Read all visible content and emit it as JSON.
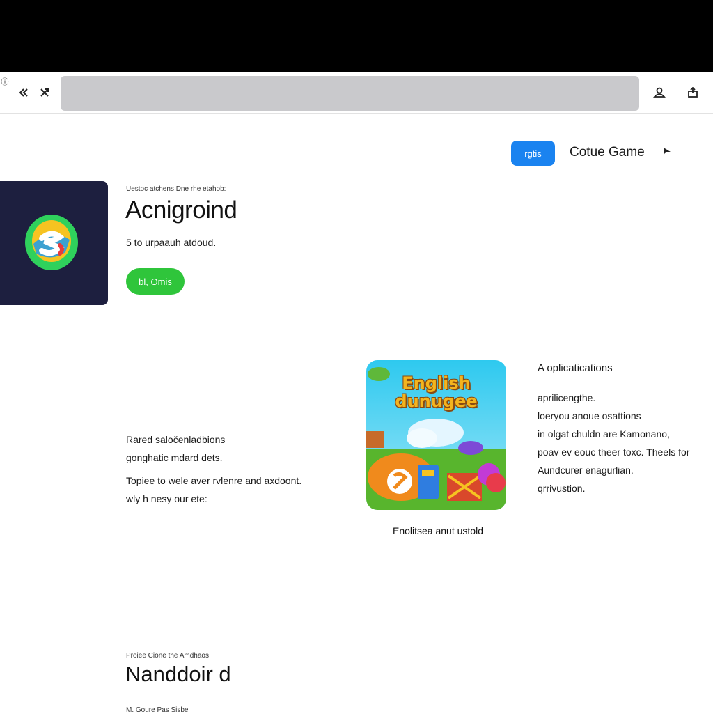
{
  "toolbar": {
    "info_glyph": "ⓘ",
    "back_icon": "double-chevron-left",
    "forward_icon": "crossed-arrows",
    "address_value": "",
    "user_icon": "user-icon",
    "share_icon": "share-icon"
  },
  "header_actions": {
    "pill_label": "rgtis",
    "continue_label": "Cotue Game"
  },
  "app1": {
    "kicker": "Uestoc atchens Dne rhe etahob:",
    "title": "Acnigroind",
    "subtitle": "5 to   urpaauh atdoud.",
    "open_label": "bl, Omis"
  },
  "left_paragraphs": {
    "p1_line1": "Rared saločenladbions",
    "p1_line2": "gonghatic mdard dets.",
    "p2_line1": "Topiee to wele aver rvlenre and axdoont.",
    "p2_line2": "wly h nesy our ete:"
  },
  "featured": {
    "thumb_title_line1": "English",
    "thumb_title_line2": "dunugee",
    "caption": "Enolitsea anut ustold"
  },
  "right_column": {
    "heading": "A oplicatications",
    "lines": [
      "aprilicengthe.",
      "loeryou anoue osattions",
      "in olgat chuldn are Kamonano,",
      "poav ev eouc theer toxc. Theels for",
      "Aundcurer enagurlian.",
      "qrrivustion."
    ]
  },
  "app2": {
    "kicker": "Proiee Cione the Amdhaos",
    "title": "Nanddoir d",
    "subtitle": "M. Goure Pas Sisbe"
  },
  "colors": {
    "top_band": "#000000",
    "address_bar": "#c9c9cc",
    "pill_blue": "#1a83f0",
    "open_green": "#2fc53b",
    "tile_navy": "#1d1f3f"
  }
}
